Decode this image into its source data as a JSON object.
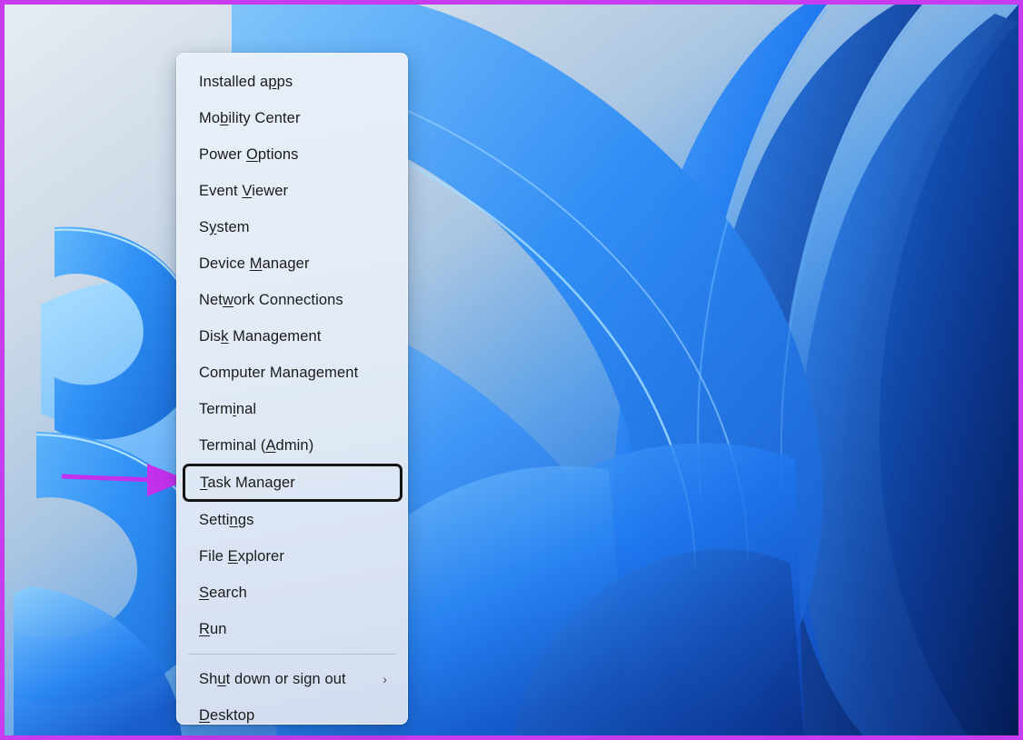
{
  "annotation": {
    "border_color": "#c83cf0",
    "arrow_color": "#c431ee",
    "arrow_name": "highlight-arrow",
    "points_to": "Task Manager"
  },
  "desktop": {
    "wallpaper_name": "windows-11-bloom-wallpaper",
    "background_colors": [
      "#dfe7ef",
      "#9fc0de",
      "#2f7fe8",
      "#0b3fae"
    ]
  },
  "menu": {
    "name": "win-x-power-user-menu",
    "highlight_border_color": "#151515",
    "selected_item": "Task Manager",
    "items": [
      {
        "label": "Installed apps",
        "pre": "Installed a",
        "acc": "p",
        "post": "ps",
        "submenu": false
      },
      {
        "label": "Mobility Center",
        "pre": "Mo",
        "acc": "b",
        "post": "ility Center",
        "submenu": false
      },
      {
        "label": "Power Options",
        "pre": "Power ",
        "acc": "O",
        "post": "ptions",
        "submenu": false
      },
      {
        "label": "Event Viewer",
        "pre": "Event ",
        "acc": "V",
        "post": "iewer",
        "submenu": false
      },
      {
        "label": "System",
        "pre": "S",
        "acc": "y",
        "post": "stem",
        "submenu": false
      },
      {
        "label": "Device Manager",
        "pre": "Device ",
        "acc": "M",
        "post": "anager",
        "submenu": false
      },
      {
        "label": "Network Connections",
        "pre": "Net",
        "acc": "w",
        "post": "ork Connections",
        "submenu": false
      },
      {
        "label": "Disk Management",
        "pre": "Dis",
        "acc": "k",
        "post": " Management",
        "submenu": false
      },
      {
        "label": "Computer Management",
        "pre": "Computer Mana",
        "acc": "g",
        "post": "ement",
        "submenu": false
      },
      {
        "label": "Terminal",
        "pre": "Term",
        "acc": "i",
        "post": "nal",
        "submenu": false
      },
      {
        "label": "Terminal (Admin)",
        "pre": "Terminal (",
        "acc": "A",
        "post": "dmin)",
        "submenu": false
      },
      {
        "label": "Task Manager",
        "pre": "",
        "acc": "T",
        "post": "ask Manager",
        "submenu": false
      },
      {
        "label": "Settings",
        "pre": "Setti",
        "acc": "n",
        "post": "gs",
        "submenu": false
      },
      {
        "label": "File Explorer",
        "pre": "File ",
        "acc": "E",
        "post": "xplorer",
        "submenu": false
      },
      {
        "label": "Search",
        "pre": "",
        "acc": "S",
        "post": "earch",
        "submenu": false
      },
      {
        "label": "Run",
        "pre": "",
        "acc": "R",
        "post": "un",
        "submenu": false
      },
      {
        "label": "Shut down or sign out",
        "pre": "Sh",
        "acc": "u",
        "post": "t down or sign out",
        "submenu": true,
        "chevron": "›"
      },
      {
        "label": "Desktop",
        "pre": "",
        "acc": "D",
        "post": "esktop",
        "submenu": false
      }
    ],
    "separator_before_index": 16
  }
}
